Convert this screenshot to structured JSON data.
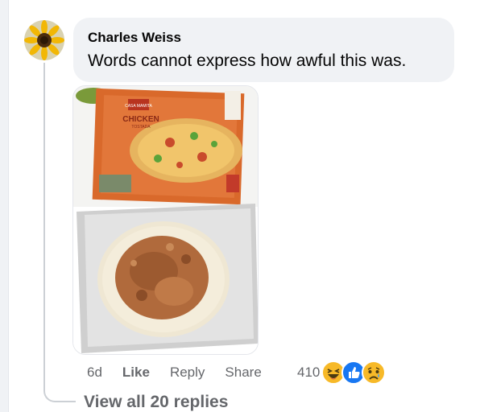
{
  "comment": {
    "author": "Charles Weiss",
    "text": "Words cannot express how awful this was.",
    "avatar_icon": "sunflower-avatar-icon"
  },
  "photo": {
    "box_brand": "CASA MAMITA",
    "box_product": "CHICKEN",
    "box_subtitle": "TOSTADA"
  },
  "actions": {
    "time": "6d",
    "like": "Like",
    "reply": "Reply",
    "share": "Share"
  },
  "reactions": {
    "count": "410",
    "icons": [
      "haha-icon",
      "like-icon",
      "sad-icon"
    ]
  },
  "view_replies": "View all 20 replies",
  "colors": {
    "bubble_bg": "#f0f2f5",
    "secondary_text": "#65676b",
    "like_blue": "#1877f2",
    "reaction_yellow": "#f7b928"
  }
}
